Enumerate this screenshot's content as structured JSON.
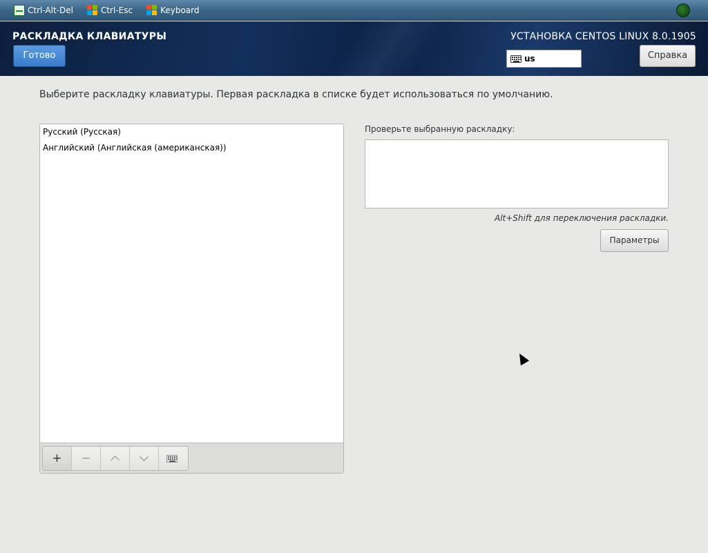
{
  "remote_bar": {
    "buttons": [
      {
        "label": "Ctrl-Alt-Del",
        "icon": "monitor-icon"
      },
      {
        "label": "Ctrl-Esc",
        "icon": "windows-icon"
      },
      {
        "label": "Keyboard",
        "icon": "windows-icon"
      }
    ],
    "status_icon": "connection-status-icon"
  },
  "header": {
    "title": "РАСКЛАДКА КЛАВИАТУРЫ",
    "done_label": "Готово",
    "product": "УСТАНОВКА CENTOS LINUX 8.0.1905",
    "layout_indicator": "us",
    "help_label": "Справка"
  },
  "main": {
    "instruction": "Выберите раскладку клавиатуры. Первая раскладка в списке будет использоваться по умолчанию.",
    "layouts": [
      "Русский (Русская)",
      "Английский (Английская (американская))"
    ],
    "toolbar": {
      "add_label": "+",
      "remove_label": "−"
    },
    "test_label": "Проверьте выбранную раскладку:",
    "test_value": "",
    "switch_hint": "Alt+Shift для переключения раскладки.",
    "options_label": "Параметры"
  },
  "colors": {
    "accent": "#3a7cc9",
    "header_bg": "#0f2850",
    "content_bg": "#e8e8e7"
  }
}
